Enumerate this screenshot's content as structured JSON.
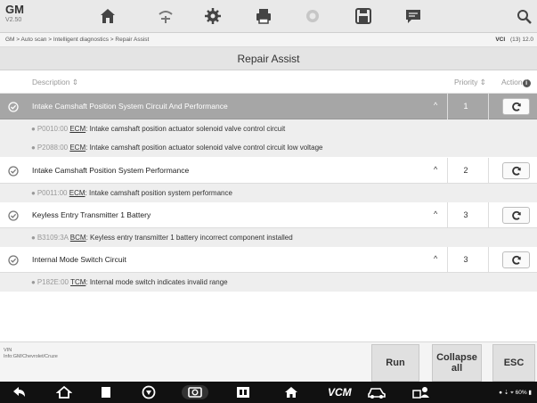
{
  "app": {
    "name": "GM",
    "version": "V2.50"
  },
  "breadcrumb": "GM > Auto scan > Intelligent diagnostics > Repair Assist",
  "status": {
    "vci": "VCI",
    "battery": "(13) 12.0"
  },
  "page": {
    "title": "Repair Assist"
  },
  "columns": {
    "description": "Description ⇕",
    "priority": "Priority ⇕",
    "action": "Action"
  },
  "systems": [
    {
      "title": "Intake Camshaft Position System Circuit And Performance",
      "priority": "1",
      "selected": true,
      "dtcs": [
        {
          "code": "P0010:00",
          "module": "ECM",
          "text": ": Intake camshaft position actuator solenoid valve control circuit"
        },
        {
          "code": "P2088:00",
          "module": "ECM",
          "text": ": Intake camshaft position actuator solenoid valve control circuit low voltage"
        }
      ]
    },
    {
      "title": "Intake Camshaft Position System Performance",
      "priority": "2",
      "selected": false,
      "dtcs": [
        {
          "code": "P0011:00",
          "module": "ECM",
          "text": ": Intake camshaft position system performance"
        }
      ]
    },
    {
      "title": "Keyless Entry Transmitter 1 Battery",
      "priority": "3",
      "selected": false,
      "dtcs": [
        {
          "code": "B3109:3A",
          "module": "BCM",
          "text": ": Keyless entry transmitter 1 battery incorrect component installed"
        }
      ]
    },
    {
      "title": "Internal Mode Switch Circuit",
      "priority": "3",
      "selected": false,
      "dtcs": [
        {
          "code": "P182E:00",
          "module": "TCM",
          "text": ": Internal mode switch indicates invalid range"
        }
      ]
    }
  ],
  "vehicle_info": {
    "label": "VIN",
    "text": "Info:GM/Chevrolet/Cruze"
  },
  "buttons": {
    "run": "Run",
    "collapse": "Collapse all",
    "esc": "ESC"
  },
  "system_bar": {
    "vcm": "VCM",
    "status": "60%"
  }
}
